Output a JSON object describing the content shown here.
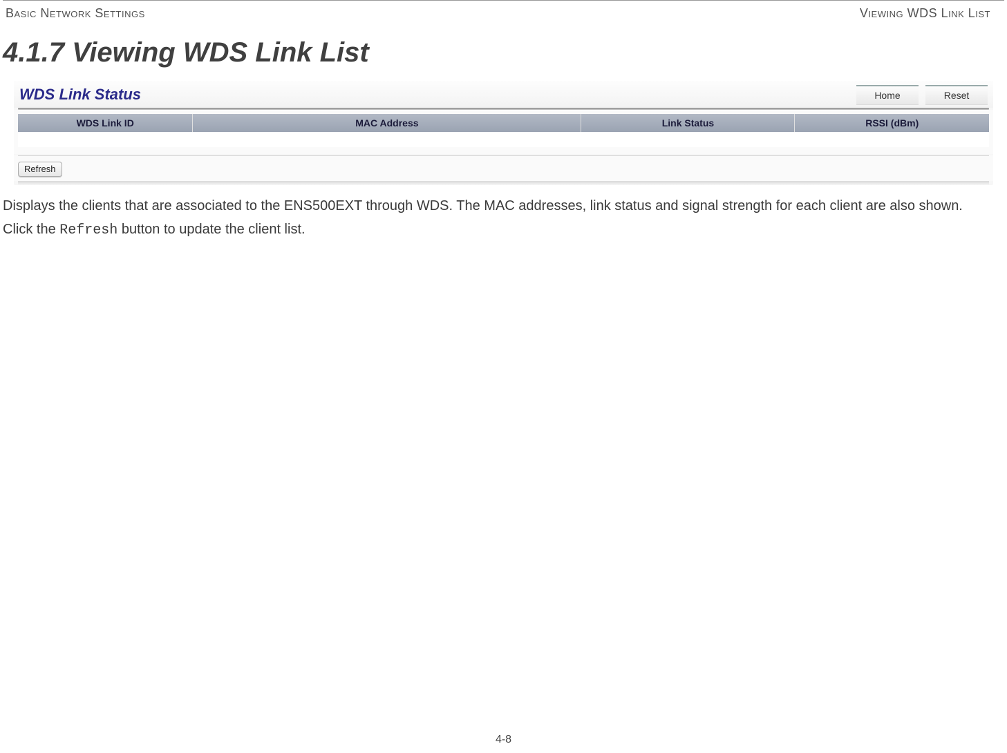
{
  "header": {
    "left": "Basic Network Settings",
    "right": "Viewing WDS Link List"
  },
  "section_title": "4.1.7 Viewing WDS Link List",
  "panel": {
    "title": "WDS Link Status",
    "home_label": "Home",
    "reset_label": "Reset",
    "columns": {
      "id": "WDS Link ID",
      "mac": "MAC Address",
      "status": "Link Status",
      "rssi": "RSSI (dBm)"
    },
    "refresh_label": "Refresh"
  },
  "description": {
    "p1": "Displays the clients that are associated to the ENS500EXT through WDS. The MAC addresses, link status and signal strength for each client are also shown.",
    "p2a": "Click the ",
    "p2b": "Refresh",
    "p2c": " button to update the client list."
  },
  "page_number": "4-8"
}
